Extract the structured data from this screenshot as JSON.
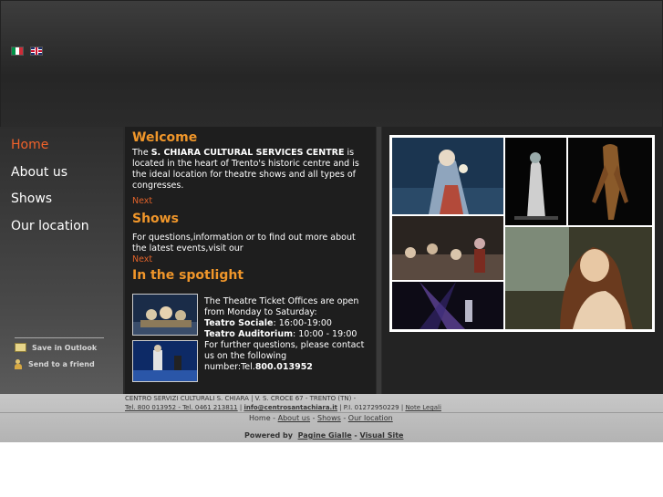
{
  "lang": {
    "it_icon": "flag-italy-icon",
    "en_icon": "flag-uk-icon"
  },
  "nav": {
    "items": [
      "Home",
      "About us",
      "Shows",
      "Our location"
    ],
    "active": "Home"
  },
  "tools": {
    "save": "Save in Outlook",
    "send": "Send to a friend"
  },
  "welcome": {
    "title": "Welcome",
    "text_prefix": "The ",
    "text_bold": "S. CHIARA CULTURAL SERVICES CENTRE",
    "text_suffix": " is located in the heart of Trento's historic centre and is the ideal location for theatre shows and all types of congresses.",
    "next": "Next"
  },
  "shows": {
    "title": "Shows",
    "text": "For questions,information or to find out more about the latest events,visit our",
    "next": "Next"
  },
  "spotlight": {
    "title": "In the spotlight",
    "intro": "The Theatre Ticket Offices are open from Monday to Saturday:",
    "sociale_label": "Teatro  Sociale",
    "sociale_hours": ": 16:00-19:00",
    "auditorium_label": "Teatro Auditorium",
    "auditorium_hours": ": 10:00 - 19:00",
    "further": "For further questions, please contact us on the following",
    "number_label": " number:Tel.",
    "number": "800.013952"
  },
  "footer": {
    "line1": "CENTRO SERVIZI CULTURALI S. CHIARA | V. S. CROCE 67 - TRENTO (TN) -",
    "tel": "Tel. 800 013952 - Tel. 0461 213811",
    "sep1": " | ",
    "email": "info@centrosantachiara.it",
    "piva": " | P.I. 01272950229 | ",
    "legal": "Note Legali",
    "links": {
      "home": "Home",
      "about": "About us",
      "shows": "Shows",
      "location": "Our location",
      "dash": " - "
    },
    "powered_by": "Powered by",
    "pagine": "Pagine Gialle",
    "visual": "Visual Site",
    "dash": " - "
  },
  "colors": {
    "accent": "#f0962a",
    "active": "#f0622a",
    "bg_dark": "#2b2b2b"
  }
}
